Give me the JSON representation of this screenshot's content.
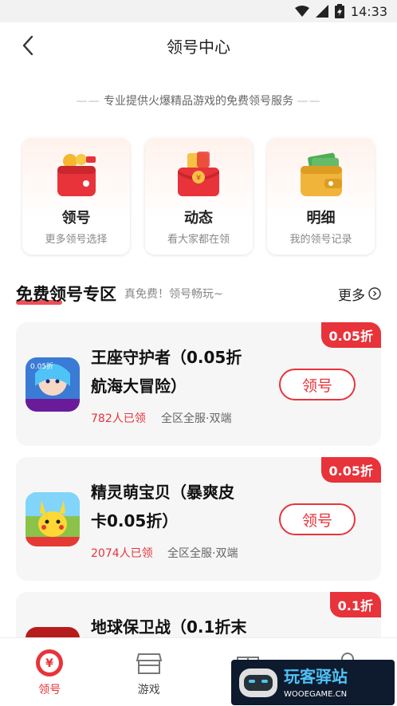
{
  "status": {
    "time": "14:33",
    "icons": [
      "wifi-icon",
      "signal-icon",
      "battery-icon"
    ]
  },
  "header": {
    "title": "领号中心",
    "back_icon": "chevron-left-icon"
  },
  "slogan": {
    "dash_left": "——",
    "text": "专业提供火爆精品游戏的免费领号服务",
    "dash_right": "——"
  },
  "features": [
    {
      "name": "领号",
      "desc": "更多领号选择",
      "icon": "wallet-coins-icon"
    },
    {
      "name": "动态",
      "desc": "看大家都在领",
      "icon": "red-envelope-icon"
    },
    {
      "name": "明细",
      "desc": "我的领号记录",
      "icon": "wallet-cash-icon"
    }
  ],
  "section": {
    "title": "免费领号专区",
    "subtitle": "真免费！领号畅玩~",
    "more_label": "更多"
  },
  "games": [
    {
      "name": "王座守护者（0.05折航海大冒险）",
      "name_line1": "王座守护者（0.05折",
      "name_line2": "航海大冒险）",
      "discount": "0.05折",
      "claimed": "782人已领",
      "tags": "全区全服·双端",
      "button": "领号",
      "icon": "fantasy-hero-game-icon"
    },
    {
      "name": "精灵萌宝贝（暴爽皮卡0.05折）",
      "name_line1": "精灵萌宝贝（暴爽皮",
      "name_line2": "卡0.05折）",
      "discount": "0.05折",
      "claimed": "2074人已领",
      "tags": "全区全服·双端",
      "button": "领号",
      "icon": "pikachu-game-icon"
    },
    {
      "name": "地球保卫战（0.1折末",
      "name_line1": "地球保卫战（0.1折末",
      "discount": "0.1折",
      "icon": "earth-defense-game-icon"
    }
  ],
  "tabbar": {
    "items": [
      {
        "label": "领号",
        "icon": "yen-coin-icon",
        "active": true
      },
      {
        "label": "游戏",
        "icon": "store-icon",
        "active": false
      },
      {
        "label": "",
        "icon": "gift-icon",
        "active": false
      },
      {
        "label": "",
        "icon": "user-icon",
        "active": false
      }
    ]
  },
  "watermark": {
    "text_top": "玩客驿站",
    "text_bottom": "WOOEGAME.CN"
  },
  "colors": {
    "accent": "#e8333a",
    "card_bg": "#f6f6f6",
    "text": "#222222"
  }
}
